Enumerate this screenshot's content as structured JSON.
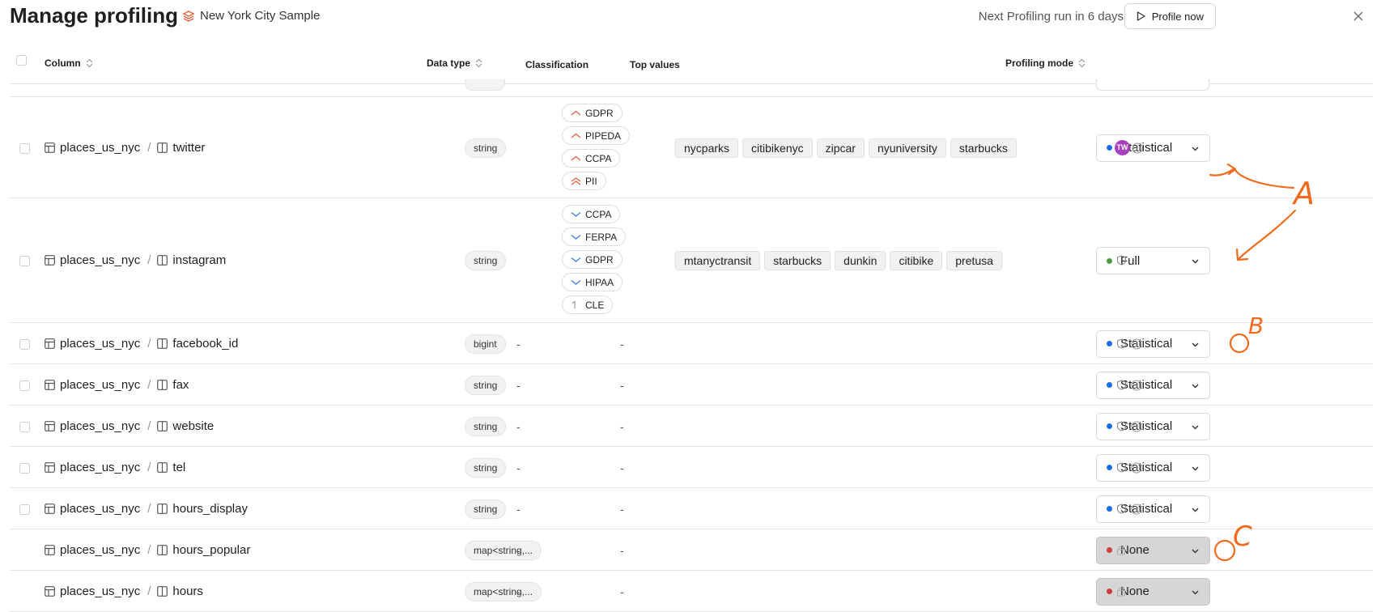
{
  "header": {
    "title": "Manage profiling",
    "dataset": "New York City Sample",
    "next_run": "Next Profiling run in 6 days",
    "profile_now": "Profile now"
  },
  "columns": {
    "column": "Column",
    "data_type": "Data type",
    "classification": "Classification",
    "top_values": "Top values",
    "profiling_mode": "Profiling mode"
  },
  "rows": [
    {
      "table": "places_us_nyc",
      "column": "twitter",
      "data_type": "string",
      "tags": [
        {
          "label": "GDPR",
          "icon": "signal-up",
          "color": "#e0623b"
        },
        {
          "label": "PIPEDA",
          "icon": "signal-up",
          "color": "#e0623b"
        },
        {
          "label": "CCPA",
          "icon": "signal-up",
          "color": "#e0623b"
        },
        {
          "label": "PII",
          "icon": "signal-double-up",
          "color": "#e0623b"
        }
      ],
      "top_values": [
        "nycparks",
        "citibikenyc",
        "zipcar",
        "nyuniversity",
        "starbucks"
      ],
      "mode": "Statistical",
      "mode_color": "#1a6cf0",
      "avatar": "TW"
    },
    {
      "table": "places_us_nyc",
      "column": "instagram",
      "data_type": "string",
      "tags": [
        {
          "label": "CCPA",
          "icon": "signal-down",
          "color": "#3f7fe6"
        },
        {
          "label": "FERPA",
          "icon": "signal-down",
          "color": "#3f7fe6"
        },
        {
          "label": "GDPR",
          "icon": "signal-down",
          "color": "#3f7fe6"
        },
        {
          "label": "HIPAA",
          "icon": "signal-down",
          "color": "#3f7fe6"
        },
        {
          "label": "CLE",
          "icon": "signal-flat",
          "color": "#999999"
        }
      ],
      "top_values": [
        "mtanyctransit",
        "starbucks",
        "dunkin",
        "citibike",
        "pretusa"
      ],
      "mode": "Full",
      "mode_color": "#4c9a3b"
    },
    {
      "table": "places_us_nyc",
      "column": "facebook_id",
      "data_type": "bigint",
      "classification": "-",
      "top_value": "-",
      "mode": "Statistical",
      "mode_color": "#1a6cf0"
    },
    {
      "table": "places_us_nyc",
      "column": "fax",
      "data_type": "string",
      "classification": "-",
      "top_value": "-",
      "mode": "Statistical",
      "mode_color": "#1a6cf0"
    },
    {
      "table": "places_us_nyc",
      "column": "website",
      "data_type": "string",
      "classification": "-",
      "top_value": "-",
      "mode": "Statistical",
      "mode_color": "#1a6cf0"
    },
    {
      "table": "places_us_nyc",
      "column": "tel",
      "data_type": "string",
      "classification": "-",
      "top_value": "-",
      "mode": "Statistical",
      "mode_color": "#1a6cf0"
    },
    {
      "table": "places_us_nyc",
      "column": "hours_display",
      "data_type": "string",
      "classification": "-",
      "top_value": "-",
      "mode": "Statistical",
      "mode_color": "#1a6cf0"
    },
    {
      "table": "places_us_nyc",
      "column": "hours_popular",
      "data_type": "map<string,...",
      "classification": "-",
      "top_value": "-",
      "mode": "None",
      "mode_color": "#d03b3b"
    },
    {
      "table": "places_us_nyc",
      "column": "hours",
      "data_type": "map<string,...",
      "classification": "-",
      "top_value": "-",
      "mode": "None",
      "mode_color": "#d03b3b"
    }
  ],
  "annotations": {
    "a": "A",
    "b": "B",
    "c": "C",
    "color": "#f26b1d"
  }
}
